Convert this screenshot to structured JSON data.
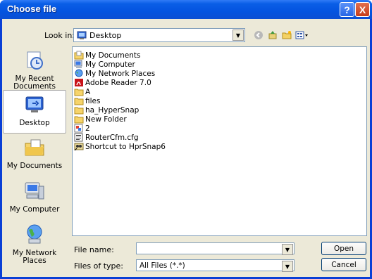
{
  "window": {
    "title": "Choose file"
  },
  "lookin": {
    "label": "Look in:",
    "value": "Desktop"
  },
  "places": [
    {
      "label": "My Recent Documents"
    },
    {
      "label": "Desktop"
    },
    {
      "label": "My Documents"
    },
    {
      "label": "My Computer"
    },
    {
      "label": "My Network Places"
    }
  ],
  "files": [
    {
      "name": "My Documents",
      "icon": "folder-docs-icon"
    },
    {
      "name": "My Computer",
      "icon": "computer-icon"
    },
    {
      "name": "My Network Places",
      "icon": "network-icon"
    },
    {
      "name": "Adobe Reader 7.0",
      "icon": "adobe-icon"
    },
    {
      "name": "A",
      "icon": "folder-icon"
    },
    {
      "name": "files",
      "icon": "folder-icon"
    },
    {
      "name": "ha_HyperSnap",
      "icon": "folder-icon"
    },
    {
      "name": "New Folder",
      "icon": "folder-icon"
    },
    {
      "name": "2",
      "icon": "image-icon"
    },
    {
      "name": "RouterCfm.cfg",
      "icon": "cfg-icon"
    },
    {
      "name": "Shortcut to HprSnap6",
      "icon": "shortcut-icon"
    }
  ],
  "filename": {
    "label": "File name:",
    "value": ""
  },
  "filetype": {
    "label": "Files of type:",
    "value": "All Files (*.*)"
  },
  "buttons": {
    "open": "Open",
    "cancel": "Cancel"
  },
  "titlebar_buttons": {
    "help": "?",
    "close": "X"
  }
}
